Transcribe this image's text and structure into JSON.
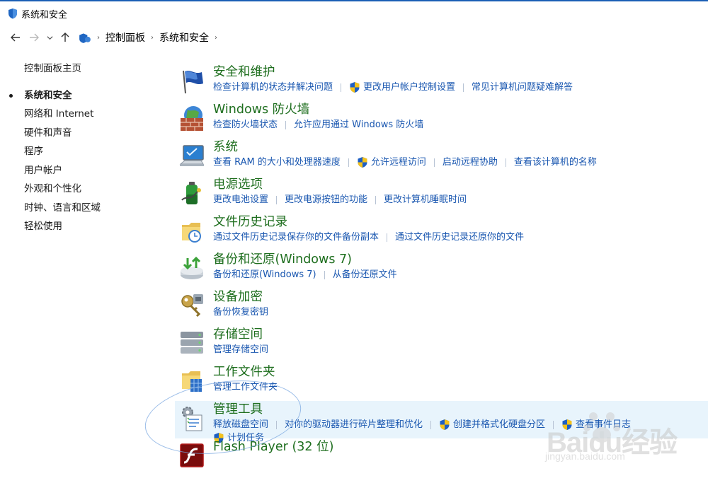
{
  "window": {
    "title": "系统和安全"
  },
  "address": {
    "crumbs": [
      "控制面板",
      "系统和安全"
    ]
  },
  "sidebar": {
    "home": "控制面板主页",
    "items": [
      {
        "label": "系统和安全",
        "active": true
      },
      {
        "label": "网络和 Internet"
      },
      {
        "label": "硬件和声音"
      },
      {
        "label": "程序"
      },
      {
        "label": "用户帐户"
      },
      {
        "label": "外观和个性化"
      },
      {
        "label": "时钟、语言和区域"
      },
      {
        "label": "轻松使用"
      }
    ]
  },
  "categories": [
    {
      "title": "安全和维护",
      "icon": "flag-icon",
      "links": [
        {
          "text": "检查计算机的状态并解决问题"
        },
        {
          "text": "更改用户帐户控制设置",
          "shield": true
        },
        {
          "text": "常见计算机问题疑难解答"
        }
      ]
    },
    {
      "title": "Windows 防火墙",
      "icon": "firewall-icon",
      "links": [
        {
          "text": "检查防火墙状态"
        },
        {
          "text": "允许应用通过 Windows 防火墙"
        }
      ]
    },
    {
      "title": "系统",
      "icon": "computer-icon",
      "links": [
        {
          "text": "查看 RAM 的大小和处理器速度"
        },
        {
          "text": "允许远程访问",
          "shield": true
        },
        {
          "text": "启动远程协助"
        },
        {
          "text": "查看该计算机的名称"
        }
      ]
    },
    {
      "title": "电源选项",
      "icon": "battery-icon",
      "links": [
        {
          "text": "更改电池设置"
        },
        {
          "text": "更改电源按钮的功能"
        },
        {
          "text": "更改计算机睡眠时间"
        }
      ]
    },
    {
      "title": "文件历史记录",
      "icon": "folder-clock-icon",
      "links": [
        {
          "text": "通过文件历史记录保存你的文件备份副本"
        },
        {
          "text": "通过文件历史记录还原你的文件"
        }
      ]
    },
    {
      "title": "备份和还原(Windows 7)",
      "icon": "backup-icon",
      "links": [
        {
          "text": "备份和还原(Windows 7)"
        },
        {
          "text": "从备份还原文件"
        }
      ]
    },
    {
      "title": "设备加密",
      "icon": "key-icon",
      "links": [
        {
          "text": "备份恢复密钥"
        }
      ]
    },
    {
      "title": "存储空间",
      "icon": "storage-icon",
      "links": [
        {
          "text": "管理存储空间"
        }
      ]
    },
    {
      "title": "工作文件夹",
      "icon": "work-folder-icon",
      "links": [
        {
          "text": "管理工作文件夹"
        }
      ]
    },
    {
      "title": "管理工具",
      "icon": "admin-tools-icon",
      "highlight": true,
      "links": [
        {
          "text": "释放磁盘空间"
        },
        {
          "text": "对你的驱动器进行碎片整理和优化"
        },
        {
          "text": "创建并格式化硬盘分区",
          "shield": true
        },
        {
          "text": "查看事件日志",
          "shield": true
        },
        {
          "text": "计划任务",
          "shield": true,
          "newline": true
        }
      ]
    },
    {
      "title": "Flash Player (32 位)",
      "icon": "flash-icon",
      "links": []
    }
  ],
  "watermark": {
    "text": "Baidu经验",
    "sub": "jingyan.baidu.com"
  },
  "colors": {
    "title_green": "#1e6e1e",
    "link_blue": "#1a57b0",
    "highlight": "#e8f4fc"
  }
}
